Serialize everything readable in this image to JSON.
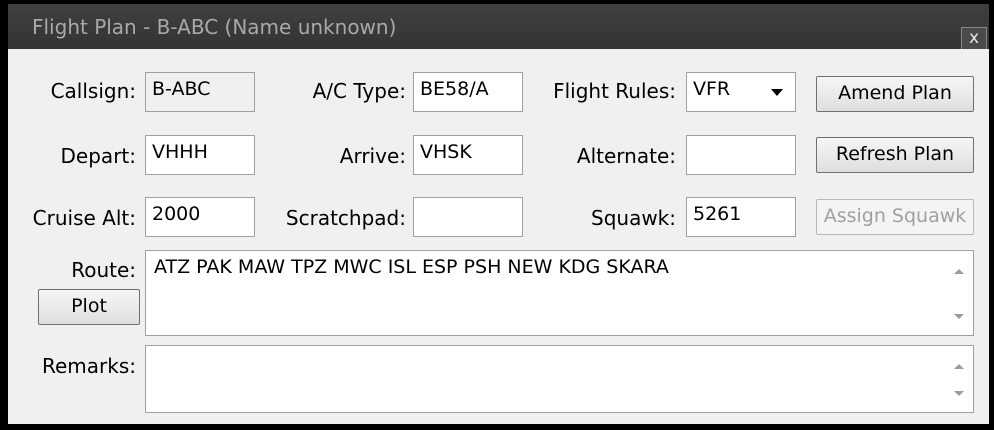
{
  "window": {
    "title": "Flight Plan - B-ABC (Name unknown)",
    "close_label": "x"
  },
  "labels": {
    "callsign": "Callsign:",
    "ac_type": "A/C Type:",
    "flight_rules": "Flight Rules:",
    "depart": "Depart:",
    "arrive": "Arrive:",
    "alternate": "Alternate:",
    "cruise_alt": "Cruise Alt:",
    "scratchpad": "Scratchpad:",
    "squawk": "Squawk:",
    "route": "Route:",
    "remarks": "Remarks:"
  },
  "fields": {
    "callsign": "B-ABC",
    "ac_type": "BE58/A",
    "flight_rules": "VFR",
    "depart": "VHHH",
    "arrive": "VHSK",
    "alternate": "",
    "cruise_alt": "2000",
    "scratchpad": "",
    "squawk": "5261",
    "route": "ATZ PAK MAW TPZ MWC ISL ESP PSH NEW KDG SKARA",
    "remarks": ""
  },
  "buttons": {
    "amend_plan": "Amend Plan",
    "refresh_plan": "Refresh Plan",
    "assign_squawk": "Assign Squawk",
    "plot": "Plot"
  },
  "icons": {
    "dropdown": "chevron-down-icon",
    "scroll_up": "scroll-up-icon",
    "scroll_down": "scroll-down-icon"
  }
}
